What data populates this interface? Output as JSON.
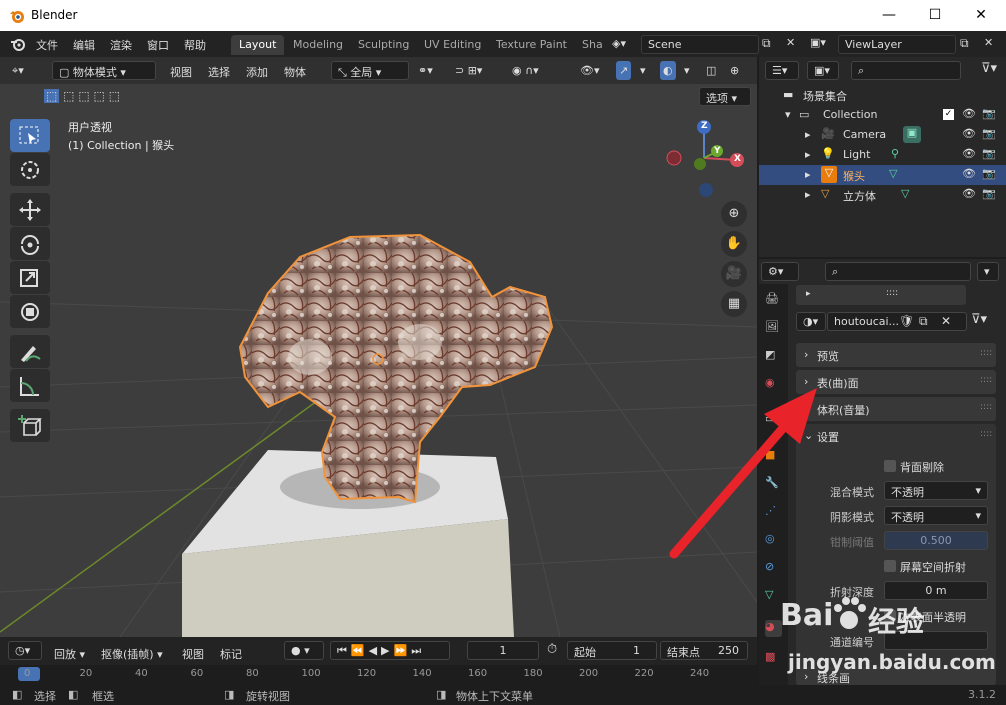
{
  "window": {
    "title": "Blender",
    "version": "3.1.2"
  },
  "menu": [
    "文件",
    "编辑",
    "渲染",
    "窗口",
    "帮助"
  ],
  "workspaces": [
    "Layout",
    "Modeling",
    "Sculpting",
    "UV Editing",
    "Texture Paint",
    "Sha"
  ],
  "scene": {
    "name": "Scene",
    "view_layer": "ViewLayer"
  },
  "viewport_header": {
    "mode": "物体模式",
    "menus": [
      "视图",
      "选择",
      "添加",
      "物体"
    ],
    "transform": "全局",
    "options": "选项"
  },
  "viewport": {
    "view_name": "用户透视",
    "context": "(1) Collection | 猴头",
    "axes": {
      "x": "X",
      "y": "Y",
      "z": "Z"
    }
  },
  "timeline": {
    "menus": [
      "回放",
      "抠像(插帧)",
      "视图",
      "标记"
    ],
    "current_frame": "1",
    "start_label": "起始",
    "start": "1",
    "end_label": "结束点",
    "end": "250",
    "ruler": [
      "0",
      "20",
      "40",
      "60",
      "80",
      "100",
      "120",
      "140",
      "160",
      "180",
      "200",
      "220",
      "240"
    ]
  },
  "status_bar": {
    "select": "选择",
    "box_select": "框选",
    "rotate": "旋转视图",
    "context_menu": "物体上下文菜单"
  },
  "outliner": {
    "root": "场景集合",
    "collection": "Collection",
    "items": [
      {
        "name": "Camera",
        "icon": "camera-icon"
      },
      {
        "name": "Light",
        "icon": "light-icon"
      },
      {
        "name": "猴头",
        "icon": "mesh-icon",
        "selected": true
      },
      {
        "name": "立方体",
        "icon": "mesh-icon"
      }
    ]
  },
  "properties": {
    "material_name": "houtoucai...",
    "panels": [
      "预览",
      "表(曲)面",
      "体积(音量)",
      "设置"
    ],
    "backface_culling": "背面剔除",
    "blend_mode_label": "混合模式",
    "blend_mode": "不透明",
    "shadow_mode_label": "阴影模式",
    "shadow_mode": "不透明",
    "clip_threshold_label": "钳制阈值",
    "clip_threshold": "0.500",
    "screen_refraction": "屏幕空间折射",
    "refraction_depth_label": "折射深度",
    "refraction_depth": "0 m",
    "subsurface_translucency": "次表面半透明",
    "pass_index_label": "通道编号",
    "line_art": "线条画"
  },
  "watermark": {
    "brand": "Bai",
    "brand2": "经验",
    "url": "jingyan.baidu.com"
  },
  "colors": {
    "selection": "#4772b3",
    "arrow": "#e8232a",
    "outline": "#f0933b"
  }
}
